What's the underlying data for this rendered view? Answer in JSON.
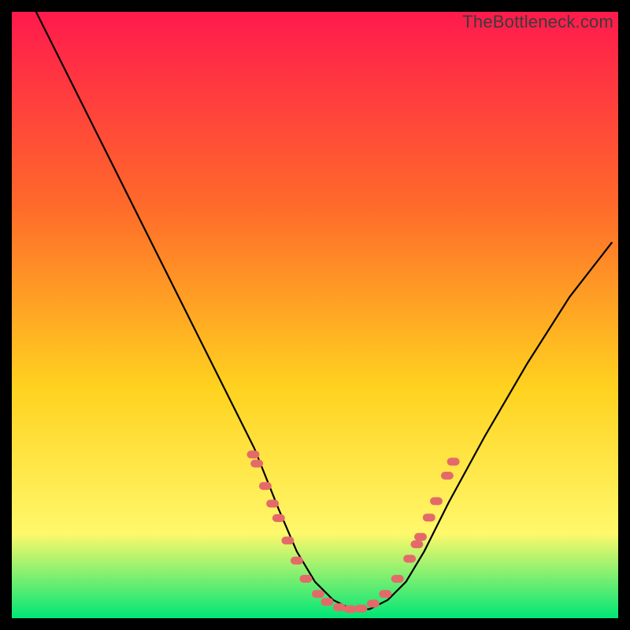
{
  "watermark": "TheBottleneck.com",
  "colors": {
    "gradient_top": "#ff1a4d",
    "gradient_mid1": "#ff6a2a",
    "gradient_mid2": "#ffd21f",
    "gradient_mid3": "#fff86b",
    "gradient_bottom": "#00e676",
    "curve": "#000000",
    "dot": "#e46a6a",
    "frame": "#000000"
  },
  "chart_data": {
    "type": "line",
    "title": "",
    "xlabel": "",
    "ylabel": "",
    "xlim": [
      0,
      1
    ],
    "ylim": [
      0,
      1
    ],
    "note": "No numeric axis labels visible; values are normalized to the plot box.",
    "series": [
      {
        "name": "bottleneck-curve",
        "x": [
          0.04,
          0.1,
          0.16,
          0.22,
          0.28,
          0.34,
          0.4,
          0.44,
          0.47,
          0.5,
          0.53,
          0.56,
          0.59,
          0.62,
          0.65,
          0.68,
          0.72,
          0.78,
          0.85,
          0.92,
          0.99
        ],
        "y": [
          1.0,
          0.88,
          0.76,
          0.64,
          0.52,
          0.4,
          0.28,
          0.18,
          0.11,
          0.06,
          0.03,
          0.015,
          0.015,
          0.03,
          0.06,
          0.11,
          0.19,
          0.3,
          0.42,
          0.53,
          0.62
        ]
      }
    ],
    "dots": {
      "name": "sample-dots",
      "points": [
        [
          0.398,
          0.27
        ],
        [
          0.404,
          0.255
        ],
        [
          0.418,
          0.218
        ],
        [
          0.43,
          0.189
        ],
        [
          0.44,
          0.165
        ],
        [
          0.455,
          0.128
        ],
        [
          0.47,
          0.095
        ],
        [
          0.485,
          0.065
        ],
        [
          0.505,
          0.04
        ],
        [
          0.52,
          0.027
        ],
        [
          0.54,
          0.018
        ],
        [
          0.558,
          0.015
        ],
        [
          0.576,
          0.016
        ],
        [
          0.596,
          0.024
        ],
        [
          0.616,
          0.04
        ],
        [
          0.636,
          0.065
        ],
        [
          0.656,
          0.098
        ],
        [
          0.668,
          0.122
        ],
        [
          0.674,
          0.134
        ],
        [
          0.688,
          0.166
        ],
        [
          0.7,
          0.193
        ],
        [
          0.718,
          0.235
        ],
        [
          0.728,
          0.258
        ]
      ]
    }
  }
}
